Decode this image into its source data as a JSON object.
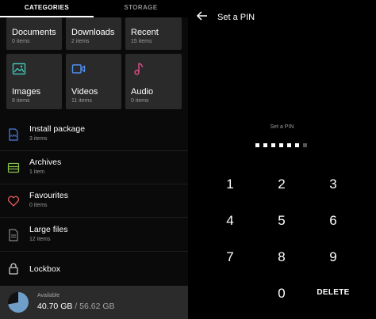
{
  "left": {
    "tabs": [
      {
        "label": "CATEGORIES",
        "active": true
      },
      {
        "label": "STORAGE",
        "active": false
      }
    ],
    "tiles": [
      {
        "title": "Documents",
        "count": "0 items",
        "icon": "document-icon"
      },
      {
        "title": "Downloads",
        "count": "2 items",
        "icon": "download-icon"
      },
      {
        "title": "Recent",
        "count": "15 items",
        "icon": "recent-icon"
      },
      {
        "title": "Images",
        "count": "9 items",
        "icon": "image-icon",
        "color": "#3fc0b0"
      },
      {
        "title": "Videos",
        "count": "11 items",
        "icon": "video-icon",
        "color": "#4f8ff0"
      },
      {
        "title": "Audio",
        "count": "0 items",
        "icon": "music-note-icon",
        "color": "#e0508a"
      }
    ],
    "list": [
      {
        "title": "Install package",
        "count": "3 items",
        "icon": "apk-icon",
        "icon_text": "APK",
        "color": "#4f7fe0"
      },
      {
        "title": "Archives",
        "count": "1 item",
        "icon": "archive-icon",
        "color": "#8bc34a"
      },
      {
        "title": "Favourites",
        "count": "0 items",
        "icon": "heart-icon",
        "color": "#e55a5a"
      },
      {
        "title": "Large files",
        "count": "12 items",
        "icon": "large-file-icon",
        "color": "#888888"
      },
      {
        "title": "Lockbox",
        "count": "",
        "icon": "lock-icon",
        "color": "#cccccc"
      }
    ],
    "storage": {
      "label": "Available",
      "used": "40.70 GB",
      "separator": " / ",
      "total": "56.62 GB",
      "used_fraction": 0.72,
      "pie_color": "#6f9fc8"
    }
  },
  "right": {
    "title": "Set a PIN",
    "prompt": "Set a PIN",
    "pin_length": 7,
    "pin_entered": 6,
    "keys": [
      "1",
      "2",
      "3",
      "4",
      "5",
      "6",
      "7",
      "8",
      "9",
      "0"
    ],
    "delete_label": "DELETE"
  }
}
